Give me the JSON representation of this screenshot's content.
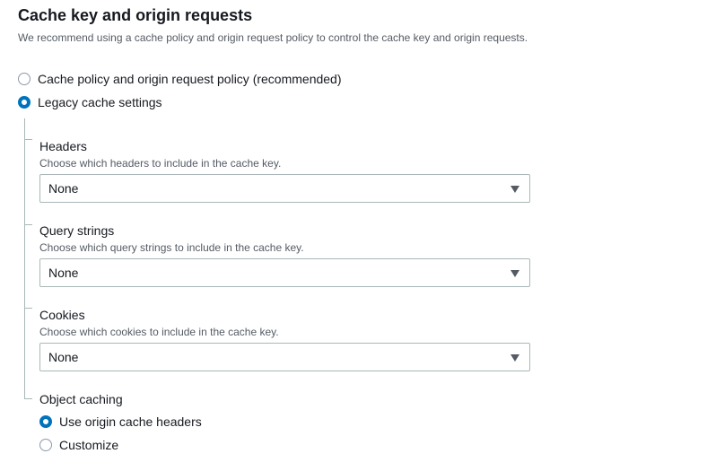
{
  "section": {
    "title": "Cache key and origin requests",
    "description": "We recommend using a cache policy and origin request policy to control the cache key and origin requests."
  },
  "cache_mode": {
    "options": [
      {
        "label": "Cache policy and origin request policy (recommended)",
        "selected": false
      },
      {
        "label": "Legacy cache settings",
        "selected": true
      }
    ]
  },
  "legacy": {
    "headers": {
      "label": "Headers",
      "description": "Choose which headers to include in the cache key.",
      "value": "None"
    },
    "query_strings": {
      "label": "Query strings",
      "description": "Choose which query strings to include in the cache key.",
      "value": "None"
    },
    "cookies": {
      "label": "Cookies",
      "description": "Choose which cookies to include in the cache key.",
      "value": "None"
    },
    "object_caching": {
      "label": "Object caching",
      "options": [
        {
          "label": "Use origin cache headers",
          "selected": true
        },
        {
          "label": "Customize",
          "selected": false
        }
      ]
    }
  },
  "colors": {
    "accent": "#0073bb",
    "text": "#16191f",
    "secondary_text": "#545b64",
    "border": "#aab7b8"
  },
  "icons": {
    "dropdown": "caret-down-icon"
  }
}
